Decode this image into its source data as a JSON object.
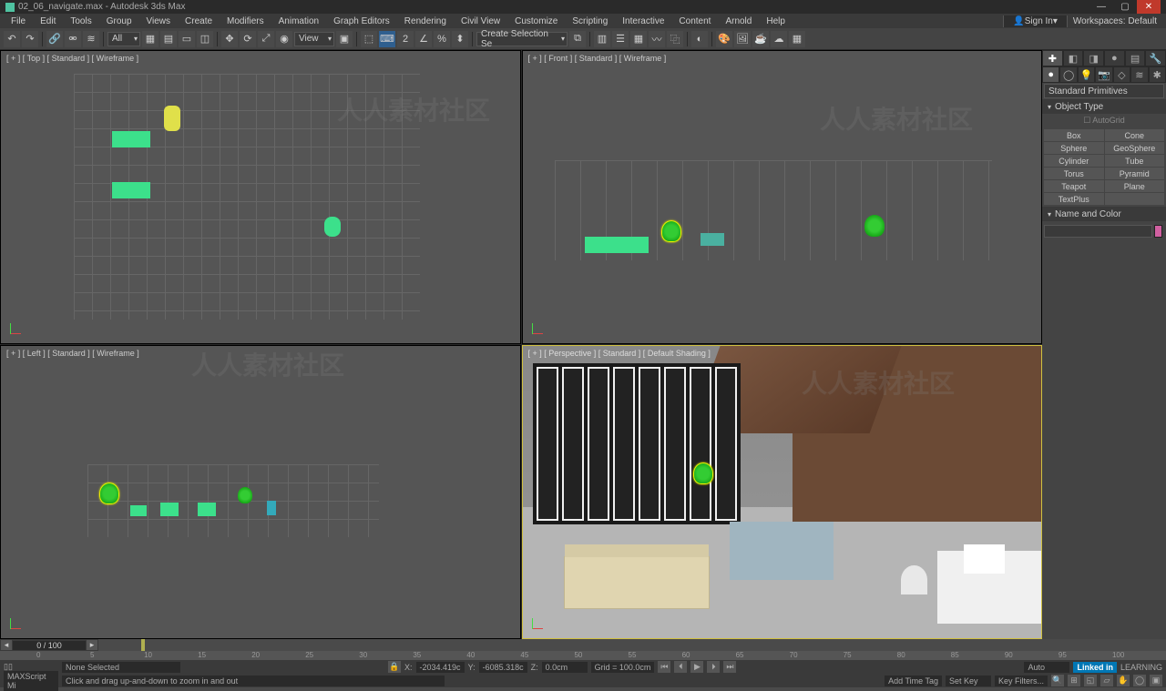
{
  "title": "02_06_navigate.max - Autodesk 3ds Max",
  "menu": [
    "File",
    "Edit",
    "Tools",
    "Group",
    "Views",
    "Create",
    "Modifiers",
    "Animation",
    "Graph Editors",
    "Rendering",
    "Civil View",
    "Customize",
    "Scripting",
    "Interactive",
    "Content",
    "Arnold",
    "Help"
  ],
  "signin": "Sign In",
  "workspace_label": "Workspaces:",
  "workspace_value": "Default",
  "toolbar": {
    "All": "All",
    "View": "View",
    "CreateSel": "Create Selection Se"
  },
  "vp": {
    "top": "[ + ] [ Top ] [ Standard ] [ Wireframe ]",
    "front": "[ + ] [ Front ] [ Standard ] [ Wireframe ]",
    "left": "[ + ] [ Left ] [ Standard ] [ Wireframe ]",
    "persp": "[ + ] [ Perspective ] [ Standard ] [ Default Shading ]"
  },
  "cmd": {
    "primDrop": "Standard Primitives",
    "objtype": "Object Type",
    "autogrid": "AutoGrid",
    "prims": [
      [
        "Box",
        "Cone"
      ],
      [
        "Sphere",
        "GeoSphere"
      ],
      [
        "Cylinder",
        "Tube"
      ],
      [
        "Torus",
        "Pyramid"
      ],
      [
        "Teapot",
        "Plane"
      ],
      [
        "TextPlus",
        ""
      ]
    ],
    "namecolor": "Name and Color"
  },
  "time": {
    "disp": "0 / 100",
    "ticks": [
      0,
      5,
      10,
      15,
      20,
      25,
      30,
      35,
      40,
      45,
      50,
      55,
      60,
      65,
      70,
      75,
      80,
      85,
      90,
      95,
      100
    ]
  },
  "status": {
    "sel": "None Selected",
    "hint": "Click and drag up-and-down to zoom in and out",
    "mini": "MAXScript Mi",
    "autokey": "Auto",
    "setkey": "Set Key",
    "keyfilters": "Key Filters...",
    "x": "X:",
    "xv": "-2034.419c",
    "y": "Y:",
    "yv": "-6085.318c",
    "z": "Z:",
    "zv": "0.0cm",
    "grid": "Grid = 100.0cm",
    "addtag": "Add Time Tag",
    "learning": "LEARNING"
  },
  "watermark": "人人素材社区"
}
